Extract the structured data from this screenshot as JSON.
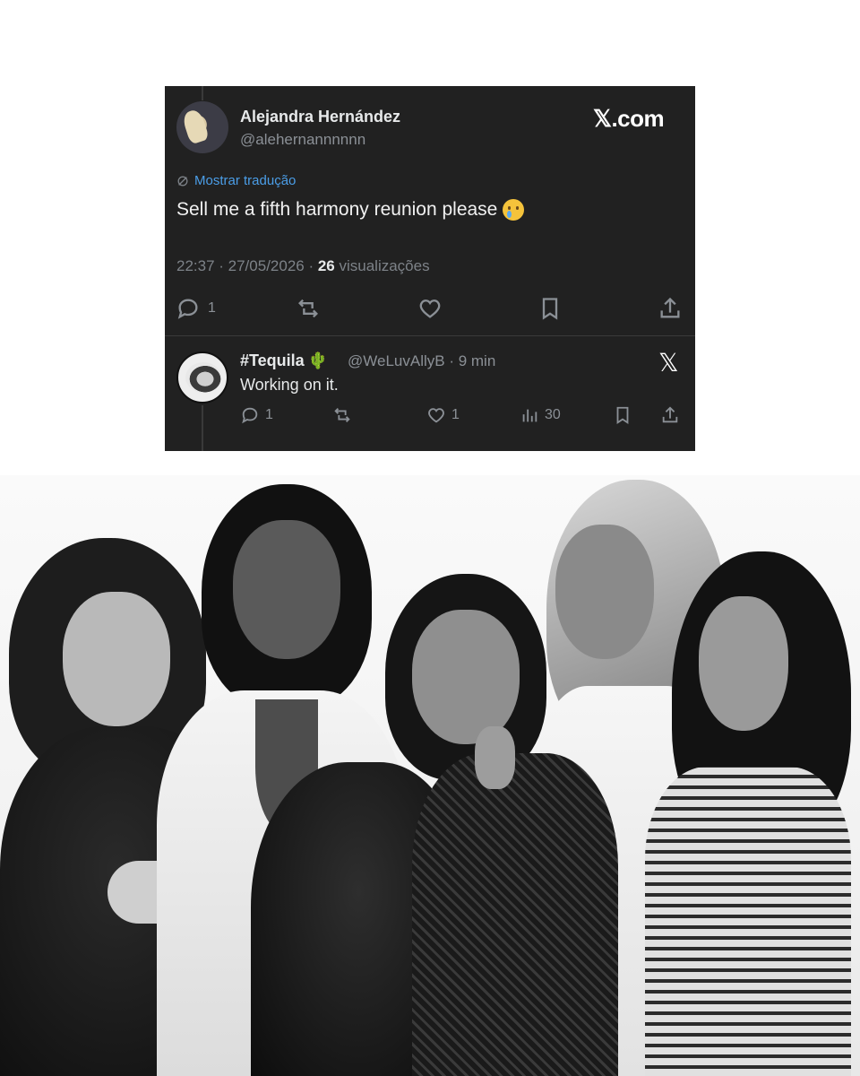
{
  "main_tweet": {
    "author_name": "Alejandra Hernández",
    "author_handle": "@alehernannnnnn",
    "brand": "𝕏.com",
    "translate_label": "Mostrar tradução",
    "text": "Sell me a fifth harmony reunion please",
    "emoji": "face-holding-back-tears",
    "time": "22:37 · 27/05/2026 · ",
    "views_count": "26",
    "views_label": " visualizações",
    "reply_count": "1"
  },
  "reply_tweet": {
    "author_name": "#Tequila",
    "author_emoji": "🌵",
    "author_handle": "@WeLuvAllyB · 9 min",
    "brand_icon": "𝕏",
    "text": "Working on it.",
    "reply_count": "1",
    "like_count": "1",
    "views_count": "30"
  },
  "colors": {
    "card_bg": "#212121",
    "link_blue": "#4b9ee8",
    "muted": "#8b9096"
  },
  "photo": {
    "description_type": "black-and-white group photo of five women",
    "people_count": 5
  }
}
